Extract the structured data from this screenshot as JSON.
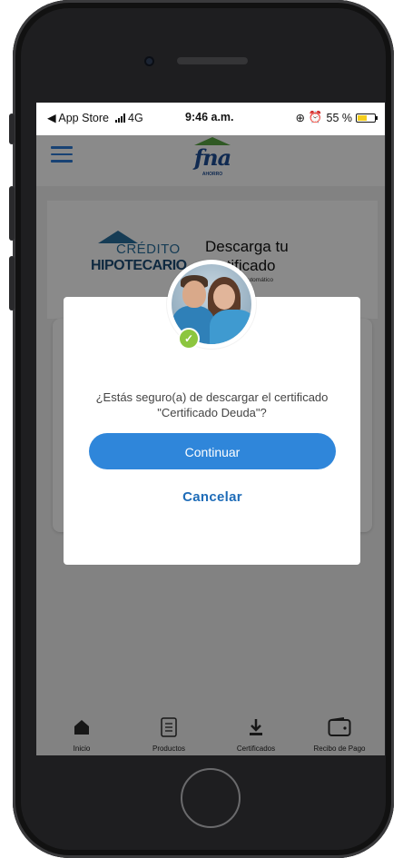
{
  "status_bar": {
    "back_label": "◀ App Store",
    "network": "4G",
    "time": "9:46 a.m.",
    "battery_percent": "55 %",
    "battery_level": 0.55
  },
  "header": {
    "logo_text": "fna",
    "logo_subtext": "AHORRO"
  },
  "hero": {
    "brand_line1": "CRÉDITO",
    "brand_line2": "HIPOTECARIO",
    "title": "Descarga tu certificado",
    "subtitle": "ficado automático"
  },
  "modal": {
    "question_line1": "¿Estás seguro(a) de descargar el certificado",
    "question_line2": "\"Certificado Deuda\"?",
    "confirm_label": "Continuar",
    "cancel_label": "Cancelar"
  },
  "bottom_nav": {
    "items": [
      {
        "label": "Inicio",
        "icon": "home-icon"
      },
      {
        "label": "Productos",
        "icon": "document-icon"
      },
      {
        "label": "Certificados",
        "icon": "download-icon"
      },
      {
        "label": "Recibo de Pago",
        "icon": "wallet-icon"
      }
    ]
  },
  "colors": {
    "primary": "#2f86da",
    "link": "#1e6cb8",
    "brand_blue": "#1f4e96",
    "brand_green": "#5aa544",
    "check_green": "#8cc63f"
  }
}
